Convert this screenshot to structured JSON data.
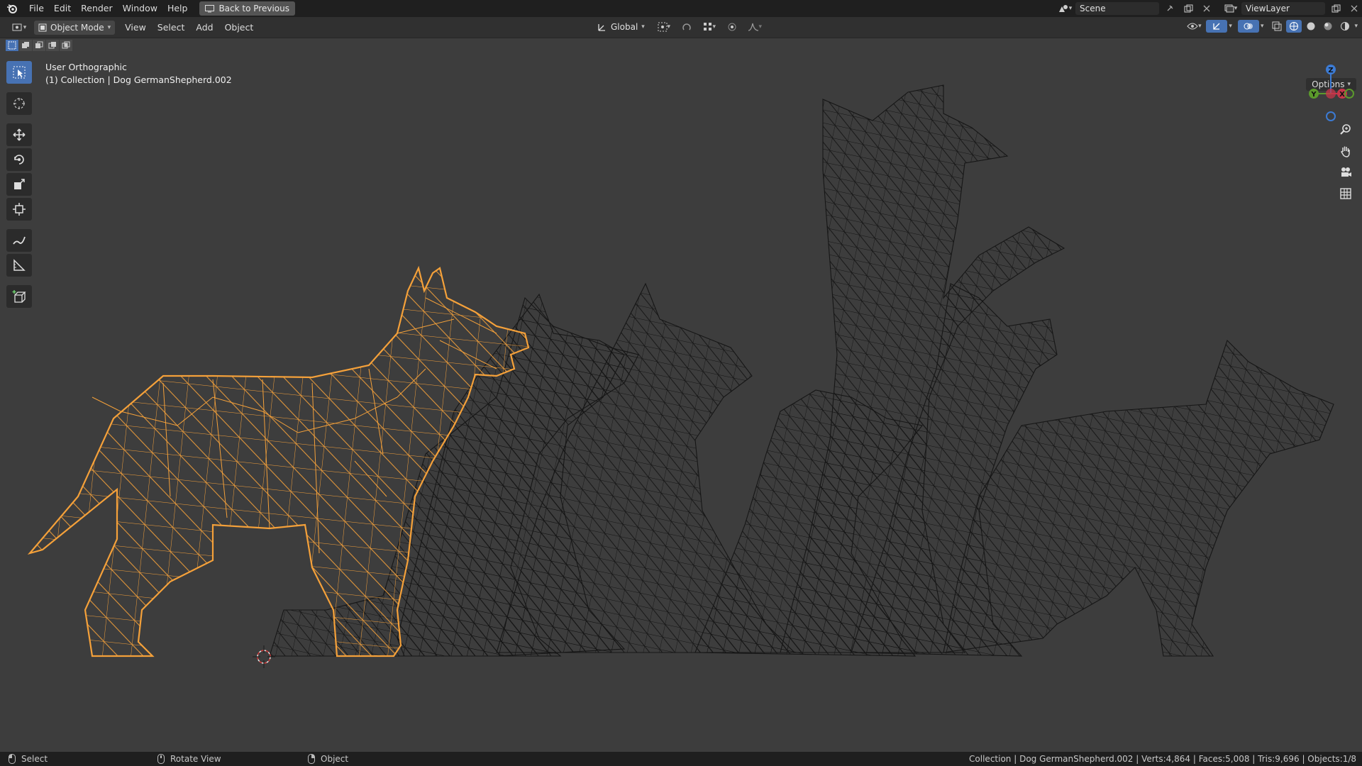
{
  "topbar": {
    "menus": [
      "File",
      "Edit",
      "Render",
      "Window",
      "Help"
    ],
    "back_button": "Back to Previous",
    "scene": "Scene",
    "view_layer": "ViewLayer"
  },
  "header": {
    "mode": "Object Mode",
    "menus": [
      "View",
      "Select",
      "Add",
      "Object"
    ],
    "orientation": "Global",
    "options": "Options"
  },
  "viewport": {
    "view_name": "User Orthographic",
    "collection_line": "(1) Collection | Dog GermanShepherd.002",
    "gizmo": {
      "z": "Z",
      "y": "Y",
      "x": "X"
    }
  },
  "statusbar": {
    "left_select": "Select",
    "middle_rotate": "Rotate View",
    "right_object": "Object",
    "stats": "Collection | Dog GermanShepherd.002 | Verts:4,864 | Faces:5,008 | Tris:9,696 | Objects:1/8"
  },
  "colors": {
    "selected": "#f5a13a",
    "wire": "#111111",
    "active_tool": "#4772b3",
    "background": "#3d3d3d"
  }
}
